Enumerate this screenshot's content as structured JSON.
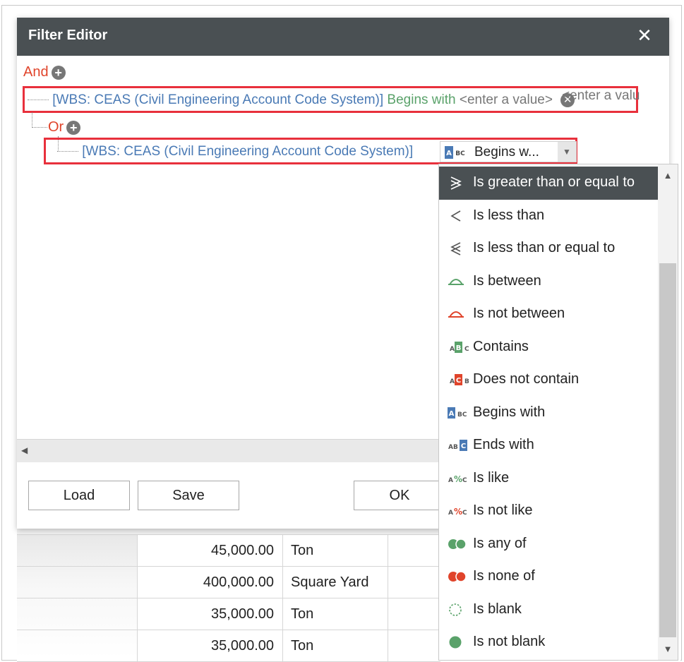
{
  "dialog": {
    "title": "Filter Editor",
    "close_glyph": "✕"
  },
  "tree": {
    "and_label": "And",
    "or_label": "Or",
    "row1": {
      "field": "[WBS: CEAS (Civil Engineering Account Code System)]",
      "operator": "Begins with",
      "value_placeholder": "<enter a value>"
    },
    "row2": {
      "field": "[WBS: CEAS (Civil Engineering Account Code System)]",
      "operator_combo": "Begins w...",
      "value_placeholder": "<enter a valu"
    }
  },
  "footer": {
    "load_label": "Load",
    "save_label": "Save",
    "ok_label": "OK"
  },
  "operators": [
    {
      "label": "Is greater than or equal to",
      "icon": "greater-equal-icon",
      "selected": true
    },
    {
      "label": "Is less than",
      "icon": "less-than-icon"
    },
    {
      "label": "Is less than or equal to",
      "icon": "less-equal-icon"
    },
    {
      "label": "Is between",
      "icon": "between-icon",
      "color": "#5aa26a"
    },
    {
      "label": "Is not between",
      "icon": "not-between-icon",
      "color": "#e0442b"
    },
    {
      "label": "Contains",
      "icon": "contains-icon",
      "color": "#5aa26a"
    },
    {
      "label": "Does not contain",
      "icon": "not-contains-icon",
      "color": "#e0442b"
    },
    {
      "label": "Begins with",
      "icon": "begins-with-icon",
      "color": "#4a7ab5"
    },
    {
      "label": "Ends with",
      "icon": "ends-with-icon",
      "color": "#4a7ab5"
    },
    {
      "label": "Is like",
      "icon": "like-icon",
      "color": "#5aa26a"
    },
    {
      "label": "Is not like",
      "icon": "not-like-icon",
      "color": "#e0442b"
    },
    {
      "label": "Is any of",
      "icon": "any-of-icon",
      "color": "#5aa26a"
    },
    {
      "label": "Is none of",
      "icon": "none-of-icon",
      "color": "#e0442b"
    },
    {
      "label": "Is blank",
      "icon": "blank-icon",
      "color": "#5aa26a"
    },
    {
      "label": "Is not blank",
      "icon": "not-blank-icon",
      "color": "#5aa26a"
    }
  ],
  "grid_rows": [
    {
      "amount": "45,000.00",
      "unit": "Ton"
    },
    {
      "amount": "400,000.00",
      "unit": "Square Yard"
    },
    {
      "amount": "35,000.00",
      "unit": "Ton"
    },
    {
      "amount": "35,000.00",
      "unit": "Ton"
    }
  ],
  "colors": {
    "titlebar": "#4a5053",
    "highlight_border": "#e8303c",
    "group_text": "#e0442b",
    "field_text": "#4a7ab5",
    "operator_text": "#5aa26a"
  }
}
